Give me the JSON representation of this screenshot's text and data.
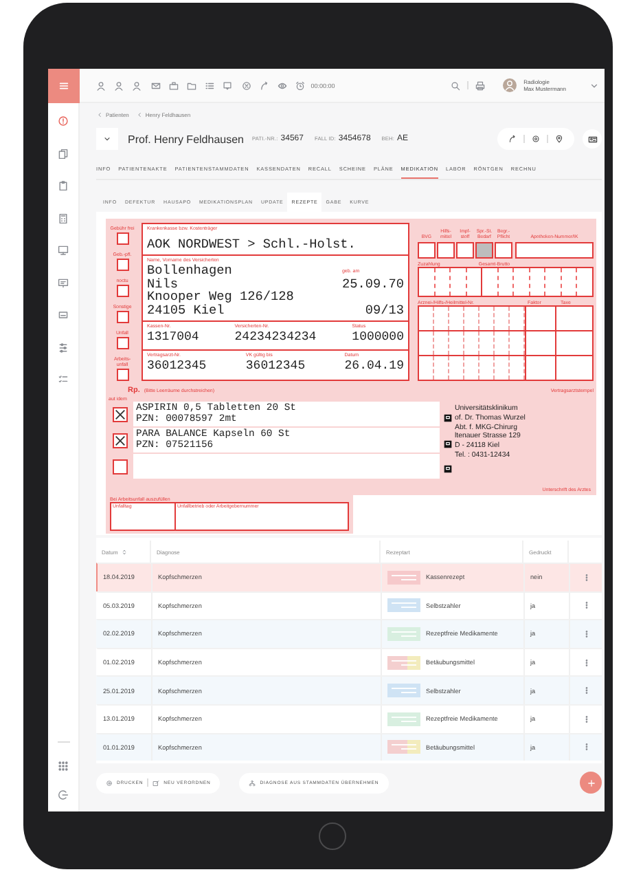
{
  "header": {
    "timer": "00:00:00",
    "user": {
      "department": "Radiologie",
      "name": "Max Mustermann"
    }
  },
  "sidebar": {
    "items": [
      {
        "selected": true
      },
      {
        "selected": false
      },
      {
        "selected": false
      },
      {
        "selected": false
      },
      {
        "selected": false
      },
      {
        "selected": false
      },
      {
        "selected": false
      },
      {
        "selected": false
      },
      {
        "selected": false
      }
    ]
  },
  "breadcrumb": [
    "Patienten",
    "Henry Feldhausen"
  ],
  "patient": {
    "name": "Prof. Henry Feldhausen",
    "fields": [
      {
        "label": "PATI.-NR.:",
        "value": "34567"
      },
      {
        "label": "FALL ID:",
        "value": "3454678"
      },
      {
        "label": "BEH:",
        "value": "AE"
      }
    ]
  },
  "tabs": [
    {
      "label": "INFO",
      "selected": false
    },
    {
      "label": "PATIENTENAKTE",
      "selected": false
    },
    {
      "label": "PATIENTENSTAMMDATEN",
      "selected": false
    },
    {
      "label": "KASSENDATEN",
      "selected": false
    },
    {
      "label": "RECALL",
      "selected": false
    },
    {
      "label": "SCHEINE",
      "selected": false
    },
    {
      "label": "PLÄNE",
      "selected": false
    },
    {
      "label": "MEDIKATION",
      "selected": true
    },
    {
      "label": "LABOR",
      "selected": false
    },
    {
      "label": "RÖNTGEN",
      "selected": false
    },
    {
      "label": "RECHNU",
      "selected": false
    }
  ],
  "subtabs": [
    {
      "label": "INFO",
      "selected": false
    },
    {
      "label": "DEFEKTUR",
      "selected": false
    },
    {
      "label": "HAUSAPO",
      "selected": false
    },
    {
      "label": "MEDIKATIONSPLAN",
      "selected": false
    },
    {
      "label": "UPDATE",
      "selected": false
    },
    {
      "label": "REZEPTE",
      "selected": true
    },
    {
      "label": "GABE",
      "selected": false
    },
    {
      "label": "KURVE",
      "selected": false
    }
  ],
  "prescription_form": {
    "flags": [
      {
        "label": "Gebühr frei",
        "checked": false
      },
      {
        "label": "Geb.-pfl.",
        "checked": false
      },
      {
        "label": "noctu",
        "checked": false
      },
      {
        "label": "Sonstige",
        "checked": false
      },
      {
        "label": "Unfall",
        "checked": false
      },
      {
        "label": "Arbeits-unfall",
        "checked": false
      }
    ],
    "insurer": {
      "label": "Krankenkasse bzw. Kostenträger",
      "value": "AOK NORDWEST > Schl.-Holst."
    },
    "insured": {
      "label": "Name, Vorname des Versicherten",
      "dob_label": "geb. am",
      "surname": "Bollenhagen",
      "first_name": "Nils",
      "dob": "25.09.70",
      "street": "Knooper Weg 126/128",
      "city": "24105 Kiel",
      "valid_until": "09/13"
    },
    "ids": [
      {
        "label": "Kassen-Nr.",
        "value": "1317004"
      },
      {
        "label": "Versicherten-Nr.",
        "value": "24234234234"
      },
      {
        "label": "Status",
        "value": "1000000"
      }
    ],
    "doctor_ids": [
      {
        "label": "Vertragsarzt-Nr.",
        "value": "36012345"
      },
      {
        "label": "VK gültig bis",
        "value": "36012345"
      },
      {
        "label": "Datum",
        "value": "26.04.19"
      }
    ],
    "codes": [
      {
        "label": "BVG",
        "shaded": false
      },
      {
        "label": "Hilfs-mittel",
        "shaded": false
      },
      {
        "label": "Impf-stoff",
        "shaded": false
      },
      {
        "label": "Spr.-St. Bedarf",
        "shaded": true
      },
      {
        "label": "Begr.-Pflicht",
        "shaded": false
      }
    ],
    "pharmacy_label": "Apotheken-Nummer/IK",
    "copay_label": "Zuzahlung",
    "gross_label": "Gesamt-Brutto",
    "item_no_label": "Arznei-/Hilfs-/Heilmittel-Nr.",
    "factor_label": "Faktor",
    "fee_label": "Taxe",
    "rp": "Rp.",
    "rp_hint": "(Bitte Leerräume durchstreichen)",
    "stamp_label": "Vertragsarztstempel",
    "aut_idem_label": "aut idem",
    "items": [
      {
        "aut_idem": true,
        "lines": [
          "ASPIRIN 0,5 Tabletten 20 St",
          "PZN: 00078597 2mt"
        ]
      },
      {
        "aut_idem": true,
        "lines": [
          "PARA BALANCE Kapseln 60 St",
          "PZN: 07521156"
        ]
      },
      {
        "aut_idem": false
      }
    ],
    "stamp": [
      "Universitätsklinikum",
      "of. Dr. Thomas Wurzel",
      "Abt. f. MKG-Chirurg",
      "ltenauer Strasse 129",
      "D - 24118 Kiel",
      "Tel. : 0431-12434"
    ],
    "signature_label": "Unterschrift des Arztes",
    "accident": {
      "label": "Bei Arbeitsunfall auszufüllen",
      "fields": [
        "Unfalltag",
        "Unfallbetrieb oder Arbeitgebernummer"
      ]
    }
  },
  "table": {
    "columns": [
      {
        "label": "Datum",
        "sortable": true
      },
      {
        "label": "Diagnose",
        "sortable": false
      },
      {
        "label": "Rezeptart",
        "sortable": false
      },
      {
        "label": "Gedruckt",
        "sortable": false
      }
    ],
    "rows": [
      {
        "date": "18.04.2019",
        "diagnosis": "Kopfschmerzen",
        "type": "Kassenrezept",
        "kind": "kassen",
        "printed": "nein",
        "selected": true
      },
      {
        "date": "05.03.2019",
        "diagnosis": "Kopfschmerzen",
        "type": "Selbstzahler",
        "kind": "selbst",
        "printed": "ja",
        "selected": false
      },
      {
        "date": "02.02.2019",
        "diagnosis": "Kopfschmerzen",
        "type": "Rezeptfreie Medikamente",
        "kind": "rezeptfrei",
        "printed": "ja",
        "selected": false
      },
      {
        "date": "01.02.2019",
        "diagnosis": "Kopfschmerzen",
        "type": "Betäubungsmittel",
        "kind": "btm",
        "printed": "ja",
        "selected": false
      },
      {
        "date": "25.01.2019",
        "diagnosis": "Kopfschmerzen",
        "type": "Selbstzahler",
        "kind": "selbst",
        "printed": "ja",
        "selected": false
      },
      {
        "date": "13.01.2019",
        "diagnosis": "Kopfschmerzen",
        "type": "Rezeptfreie Medikamente",
        "kind": "rezeptfrei",
        "printed": "ja",
        "selected": false
      },
      {
        "date": "01.01.2019",
        "diagnosis": "Kopfschmerzen",
        "type": "Betäubungsmittel",
        "kind": "btm",
        "printed": "ja",
        "selected": false
      }
    ]
  },
  "actions": [
    {
      "items": [
        {
          "label": "DRUCKEN",
          "kind": "print"
        },
        {
          "label": "NEU VERORDNEN",
          "kind": "edit"
        }
      ]
    },
    {
      "items": [
        {
          "label": "DIAGNOSE AUS STAMMDATEN ÜBERNEHMEN",
          "kind": "transfer"
        }
      ]
    }
  ]
}
